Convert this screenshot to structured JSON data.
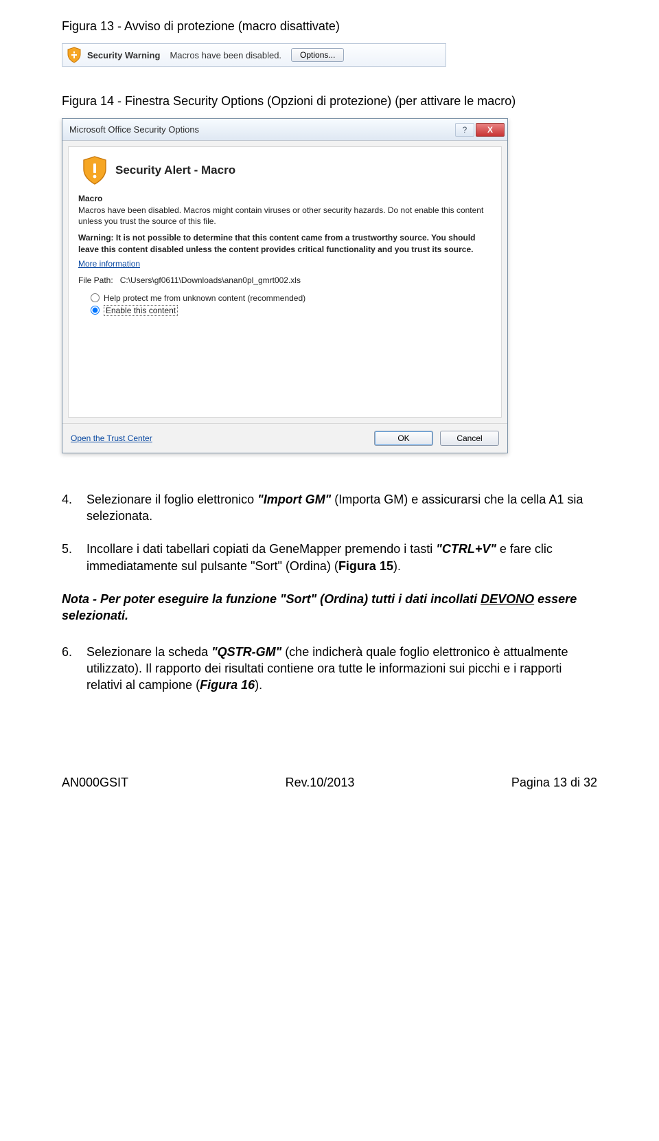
{
  "captions": {
    "fig13": "Figura 13 - Avviso di protezione (macro disattivate)",
    "fig14": "Figura 14 - Finestra Security Options (Opzioni di protezione) (per attivare le macro)"
  },
  "security_bar": {
    "title": "Security Warning",
    "message": "Macros have been disabled.",
    "options_button": "Options..."
  },
  "dialog": {
    "title": "Microsoft Office Security Options",
    "help_glyph": "?",
    "close_glyph": "X",
    "alert_title": "Security Alert - Macro",
    "section_label": "Macro",
    "para1": "Macros have been disabled. Macros might contain viruses or other security hazards. Do not enable this content unless you trust the source of this file.",
    "warning_lead": "Warning: It is not possible to determine that this content came from a trustworthy source. You should leave this content disabled unless the content provides critical functionality and you trust its source.",
    "more_info": "More information",
    "file_path_label": "File Path:",
    "file_path_value": "C:\\Users\\gf0611\\Downloads\\anan0pl_gmrt002.xls",
    "radio_protect": "Help protect me from unknown content (recommended)",
    "radio_enable": "Enable this content",
    "trust_center": "Open the Trust Center",
    "ok": "OK",
    "cancel": "Cancel"
  },
  "list": {
    "item4_num": "4.",
    "item4_a": "Selezionare il foglio elettronico ",
    "item4_b": "\"Import GM\"",
    "item4_c": " (Importa GM) e assicurarsi che la cella A1 sia selezionata.",
    "item5_num": "5.",
    "item5_a": "Incollare i dati tabellari copiati da GeneMapper premendo i tasti ",
    "item5_b": "\"CTRL+V\"",
    "item5_c": " e fare clic immediatamente sul pulsante \"Sort\" (Ordina) (",
    "item5_d": "Figura 15",
    "item5_e": ").",
    "item6_num": "6.",
    "item6_a": "Selezionare la scheda ",
    "item6_b": "\"QSTR-GM\"",
    "item6_c": " (che indicherà quale foglio elettronico è attualmente utilizzato). Il rapporto dei risultati contiene ora tutte le informazioni sui picchi e i rapporti relativi al campione (",
    "item6_d": "Figura 16",
    "item6_e": ")."
  },
  "note": {
    "a": "Nota - Per poter eseguire la funzione \"Sort\" (Ordina) tutti i dati incollati ",
    "b": "DEVONO",
    "c": " essere selezionati."
  },
  "footer": {
    "left": "AN000GSIT",
    "center": "Rev.10/2013",
    "right": "Pagina 13 di 32"
  }
}
